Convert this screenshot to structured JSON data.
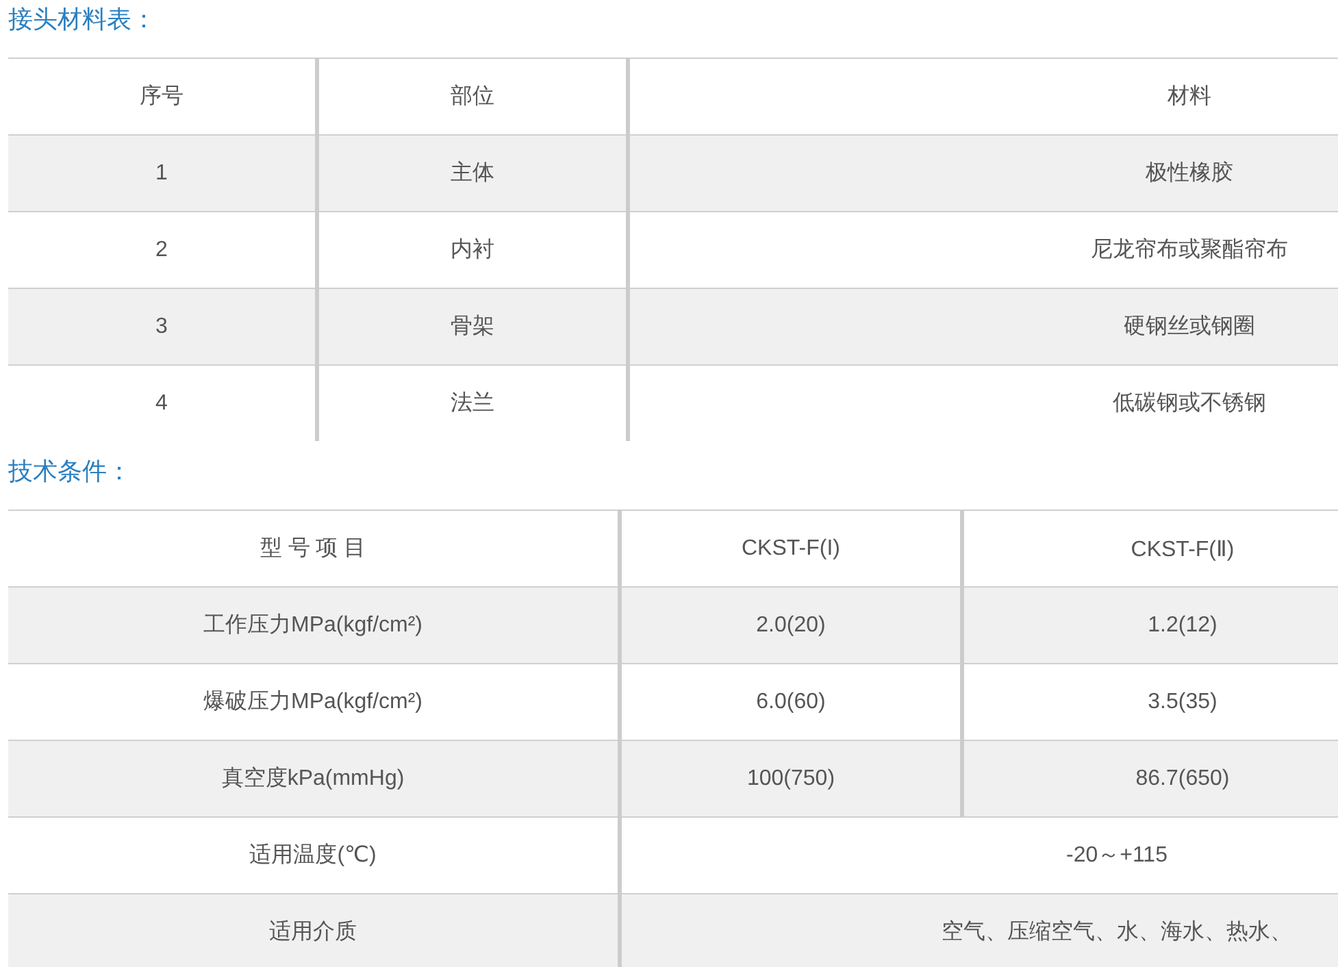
{
  "sections": [
    {
      "title": "接头材料表：",
      "table": {
        "kind": "materials",
        "columns": [
          "序号",
          "部位",
          "材料"
        ],
        "rows": [
          {
            "cells": [
              "1",
              "主体",
              "极性橡胶"
            ]
          },
          {
            "cells": [
              "2",
              "内衬",
              "尼龙帘布或聚酯帘布"
            ]
          },
          {
            "cells": [
              "3",
              "骨架",
              "硬钢丝或钢圈"
            ]
          },
          {
            "cells": [
              "4",
              "法兰",
              "低碳钢或不锈钢"
            ]
          }
        ]
      }
    },
    {
      "title": "技术条件：",
      "table": {
        "kind": "specs",
        "columns": [
          "型 号 项 目",
          "CKST-F(I)",
          "CKST-F(Ⅱ)"
        ],
        "rows": [
          {
            "cells": [
              "工作压力MPa(kgf/cm²)",
              "2.0(20)",
              "1.2(12)"
            ]
          },
          {
            "cells": [
              "爆破压力MPa(kgf/cm²)",
              "6.0(60)",
              "3.5(35)"
            ]
          },
          {
            "cells": [
              "真空度kPa(mmHg)",
              "100(750)",
              "86.7(650)"
            ]
          },
          {
            "cells": [
              "适用温度(℃)",
              {
                "text": "-20～+115",
                "colspan": 2
              }
            ]
          },
          {
            "cells": [
              "适用介质",
              {
                "text": "空气、压缩空气、水、海水、热水、",
                "colspan": 2
              }
            ]
          }
        ]
      }
    }
  ]
}
